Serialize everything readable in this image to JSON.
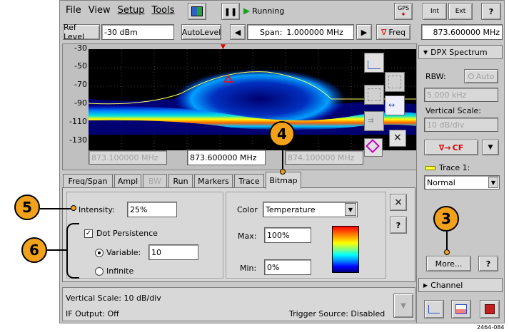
{
  "menu": {
    "file": "File",
    "view": "View",
    "setup": "Setup",
    "tools": "Tools"
  },
  "toolbar": {
    "run_status": "Running",
    "gps": "GPS",
    "int_label": "Int",
    "ext_label": "Ext",
    "help": "?",
    "ref_level_label": "Ref Level",
    "ref_level_value": "-30 dBm",
    "autolevel_label": "AutoLevel",
    "span_label": "Span:",
    "span_value": "1.000000 MHz",
    "freq_label": "Freq",
    "freq_value": "873.600000 MHz"
  },
  "plot": {
    "y_ticks": [
      "-30",
      "-50",
      "-70",
      "-90",
      "-110",
      "-130"
    ],
    "freq_left": "873.100000 MHz",
    "freq_center": "873.600000 MHz",
    "freq_right": "874.100000 MHz"
  },
  "tabs": [
    "Freq/Span",
    "Ampl",
    "BW",
    "Run",
    "Markers",
    "Trace",
    "Bitmap"
  ],
  "bitmap": {
    "intensity_label": "Intensity:",
    "intensity_value": "25%",
    "color_label": "Color",
    "color_value": "Temperature",
    "dot_persistence_label": "Dot Persistence",
    "variable_label": "Variable:",
    "variable_value": "10",
    "infinite_label": "Infinite",
    "max_label": "Max:",
    "max_value": "100%",
    "min_label": "Min:",
    "min_value": "0%",
    "close": "×",
    "help": "?"
  },
  "status": {
    "vertical_scale": "Vertical Scale: 10 dB/div",
    "if_output": "IF Output: Off",
    "trigger_source": "Trigger Source: Disabled"
  },
  "sidebar": {
    "dpx_header": "DPX Spectrum",
    "rbw_label": "RBW:",
    "auto_label": "Auto",
    "rbw_value": "5.000 kHz",
    "vscale_label": "Vertical Scale:",
    "vscale_value": "10 dB/div",
    "cf_label": "CF",
    "trace_label": "Trace 1:",
    "trace_value": "Normal",
    "more_label": "More...",
    "help": "?",
    "channel_header": "Channel"
  },
  "callouts": [
    "4",
    "5",
    "6",
    "3"
  ],
  "figure_id": "2464-084",
  "colors": {
    "accent_red": "#e00000",
    "callout": "#f2a11a",
    "trace_yellow": "#ffff40"
  }
}
